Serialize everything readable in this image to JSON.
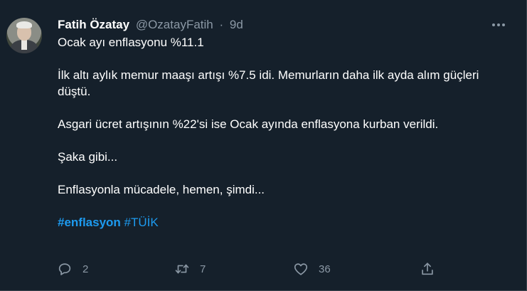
{
  "user": {
    "display_name": "Fatih Özatay",
    "handle": "@OzatayFatih",
    "separator": "·",
    "time": "9d"
  },
  "tweet": {
    "paragraphs": [
      "Ocak ayı enflasyonu %11.1",
      "İlk altı aylık memur maaşı artışı %7.5 idi. Memurların daha ilk ayda alım güçleri düştü.",
      "Asgari ücret artışının %22'si ise Ocak ayında enflasyona kurban verildi.",
      "Şaka gibi...",
      "Enflasyonla mücadele, hemen, şimdi..."
    ],
    "hashtags": [
      "#enflasyon",
      "#TÜİK"
    ]
  },
  "actions": {
    "reply_count": "2",
    "retweet_count": "7",
    "like_count": "36"
  },
  "icons": {
    "more": "more-horizontal-icon",
    "reply": "reply-icon",
    "retweet": "retweet-icon",
    "like": "like-icon",
    "share": "share-icon"
  },
  "colors": {
    "background": "#15202b",
    "text": "#ffffff",
    "muted": "#8b98a5",
    "link": "#1d9bf0",
    "border": "#38444d"
  }
}
